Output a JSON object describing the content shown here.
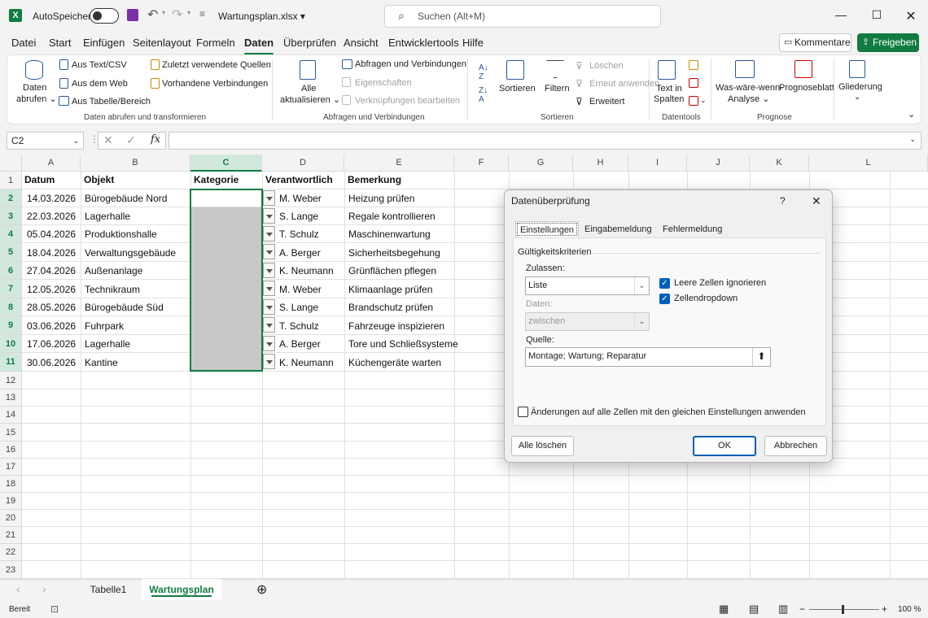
{
  "title": {
    "autosave": "AutoSpeichern",
    "filename": "Wartungsplan.xlsx",
    "search_placeholder": "Suchen (Alt+M)"
  },
  "menu": [
    "Datei",
    "Start",
    "Einfügen",
    "Seitenlayout",
    "Formeln",
    "Daten",
    "Überprüfen",
    "Ansicht",
    "Entwicklertools",
    "Hilfe"
  ],
  "menu_active": "Daten",
  "buttons": {
    "comments": "Kommentare",
    "share": "Freigeben"
  },
  "ribbon": {
    "daten_abrufen_1": "Daten",
    "daten_abrufen_2": "abrufen",
    "aus_text": "Aus Text/CSV",
    "aus_web": "Aus dem Web",
    "aus_tabelle": "Aus Tabelle/Bereich",
    "zuletzt": "Zuletzt verwendete Quellen",
    "vorhandene": "Vorhandene Verbindungen",
    "group1": "Daten abrufen und transformieren",
    "alle_1": "Alle",
    "alle_2": "aktualisieren",
    "abfragen": "Abfragen und Verbindungen",
    "eigenschaften": "Eigenschaften",
    "verknuepfungen": "Verknüpfungen bearbeiten",
    "group2": "Abfragen und Verbindungen",
    "sortieren": "Sortieren",
    "filtern": "Filtern",
    "loeschen": "Löschen",
    "erneut": "Erneut anwenden",
    "erweitert": "Erweitert",
    "group3": "Sortieren",
    "text_spalten_1": "Text in",
    "text_spalten_2": "Spalten",
    "group4": "Datentools",
    "was_waere_1": "Was-wäre-wenn-",
    "was_waere_2": "Analyse",
    "prognoseblatt": "Prognoseblatt",
    "group5": "Prognose",
    "gliederung": "Gliederung"
  },
  "namebox": "C2",
  "columns": [
    "A",
    "B",
    "C",
    "D",
    "E",
    "F",
    "G",
    "H",
    "I",
    "J",
    "K",
    "L"
  ],
  "headers": {
    "datum": "Datum",
    "objekt": "Objekt",
    "kategorie": "Kategorie",
    "verantwortlich": "Verantwortlich",
    "bemerkung": "Bemerkung"
  },
  "rows": [
    {
      "datum": "14.03.2026",
      "objekt": "Bürogebäude Nord",
      "verantwortlich": "M. Weber",
      "bemerkung": "Heizung prüfen"
    },
    {
      "datum": "22.03.2026",
      "objekt": "Lagerhalle",
      "verantwortlich": "S. Lange",
      "bemerkung": "Regale kontrollieren"
    },
    {
      "datum": "05.04.2026",
      "objekt": "Produktionshalle",
      "verantwortlich": "T. Schulz",
      "bemerkung": "Maschinenwartung"
    },
    {
      "datum": "18.04.2026",
      "objekt": "Verwaltungsgebäude",
      "verantwortlich": "A. Berger",
      "bemerkung": "Sicherheitsbegehung"
    },
    {
      "datum": "27.04.2026",
      "objekt": "Außenanlage",
      "verantwortlich": "K. Neumann",
      "bemerkung": "Grünflächen pflegen"
    },
    {
      "datum": "12.05.2026",
      "objekt": "Technikraum",
      "verantwortlich": "M. Weber",
      "bemerkung": "Klimaanlage prüfen"
    },
    {
      "datum": "28.05.2026",
      "objekt": "Bürogebäude Süd",
      "verantwortlich": "S. Lange",
      "bemerkung": "Brandschutz prüfen"
    },
    {
      "datum": "03.06.2026",
      "objekt": "Fuhrpark",
      "verantwortlich": "T. Schulz",
      "bemerkung": "Fahrzeuge inspizieren"
    },
    {
      "datum": "17.06.2026",
      "objekt": "Lagerhalle",
      "verantwortlich": "A. Berger",
      "bemerkung": "Tore und Schließsysteme"
    },
    {
      "datum": "30.06.2026",
      "objekt": "Kantine",
      "verantwortlich": "K. Neumann",
      "bemerkung": "Küchengeräte warten"
    }
  ],
  "row_numbers": [
    "1",
    "2",
    "3",
    "4",
    "5",
    "6",
    "7",
    "8",
    "9",
    "10",
    "11",
    "12",
    "13",
    "14",
    "15",
    "16",
    "17",
    "18",
    "19",
    "20",
    "21",
    "22",
    "23"
  ],
  "dialog": {
    "title": "Datenüberprüfung",
    "help": "?",
    "tabs": [
      "Einstellungen",
      "Eingabemeldung",
      "Fehlermeldung"
    ],
    "criteria": "Gültigkeitskriterien",
    "zulassen_label": "Zulassen:",
    "zulassen_value": "Liste",
    "daten_label": "Daten:",
    "daten_value": "zwischen",
    "leere_zellen": "Leere Zellen ignorieren",
    "zellendropdown": "Zellendropdown",
    "quelle_label": "Quelle:",
    "quelle_value": "Montage; Wartung; Reparatur",
    "apply_all": "Änderungen auf alle Zellen mit den gleichen Einstellungen anwenden",
    "clear_all": "Alle löschen",
    "ok": "OK",
    "cancel": "Abbrechen"
  },
  "sheets": [
    "Tabelle1",
    "Wartungsplan"
  ],
  "active_sheet": "Wartungsplan",
  "status": {
    "ready": "Bereit",
    "zoom": "100 %"
  }
}
